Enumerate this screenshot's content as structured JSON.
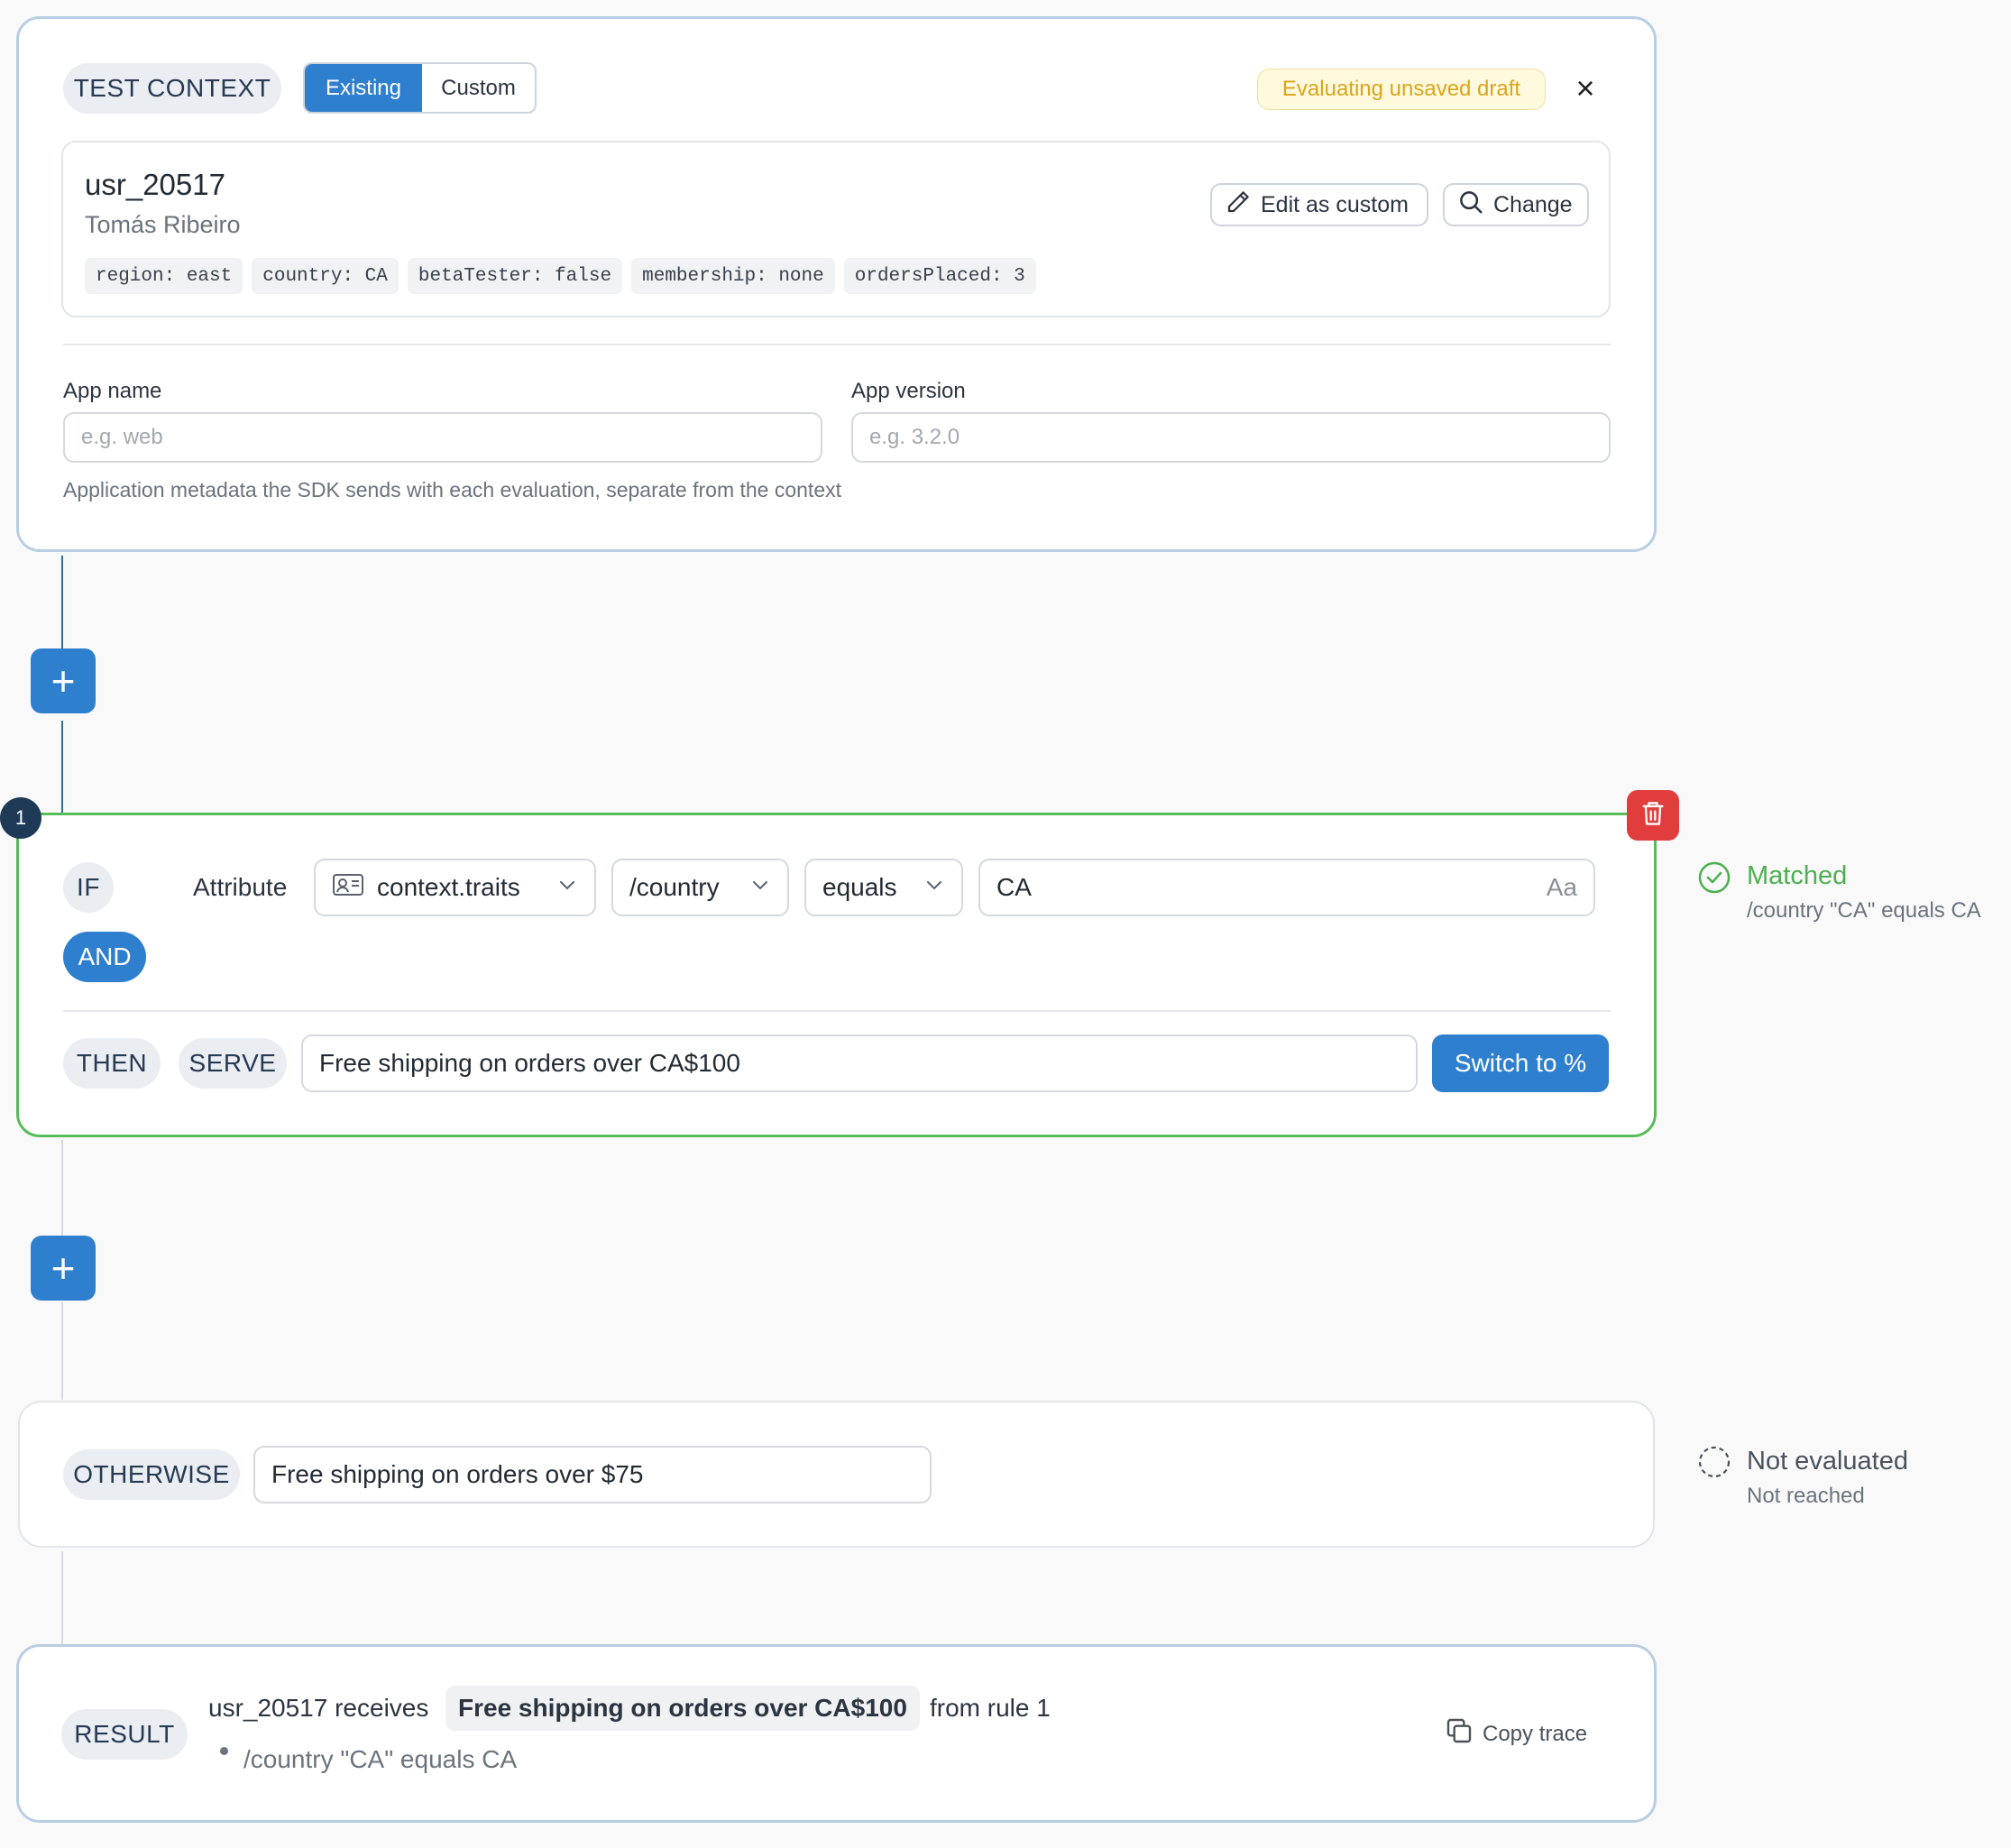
{
  "test_context": {
    "label": "TEST CONTEXT",
    "mode_existing": "Existing",
    "mode_custom": "Custom",
    "draft_badge": "Evaluating unsaved draft",
    "close_icon": "×",
    "user_id": "usr_20517",
    "user_name": "Tomás Ribeiro",
    "traits": [
      "region: east",
      "country: CA",
      "betaTester: false",
      "membership: none",
      "ordersPlaced: 3"
    ],
    "edit_button": "Edit as custom",
    "change_button": "Change",
    "app_name_label": "App name",
    "app_name_placeholder": "e.g. web",
    "app_version_label": "App version",
    "app_version_placeholder": "e.g. 3.2.0",
    "help_text": "Application metadata the SDK sends with each evaluation, separate from the context"
  },
  "rule": {
    "number": "1",
    "if_label": "IF",
    "attribute_label": "Attribute",
    "source": "context.traits",
    "path": "/country",
    "operator": "equals",
    "value": "CA",
    "case_icon_text": "Aa",
    "and_label": "AND",
    "then_label": "THEN",
    "serve_label": "SERVE",
    "serve_value": "Free shipping on orders over CA$100",
    "switch_button": "Switch to %",
    "status_title": "Matched",
    "status_detail": "/country \"CA\" equals CA",
    "status_color": "#4caf50"
  },
  "otherwise": {
    "label": "OTHERWISE",
    "value": "Free shipping on orders over $75",
    "status_title": "Not evaluated",
    "status_detail": "Not reached"
  },
  "result": {
    "label": "RESULT",
    "user": "usr_20517 receives",
    "value": "Free shipping on orders over CA$100",
    "from": "from rule 1",
    "trace_item": "/country \"CA\" equals CA",
    "copy_button": "Copy trace"
  },
  "plus_symbol": "+",
  "colors": {
    "accent": "#2f7fcf",
    "match": "#58bc5a",
    "danger": "#e23d3d",
    "draft": "#d9a51c"
  }
}
